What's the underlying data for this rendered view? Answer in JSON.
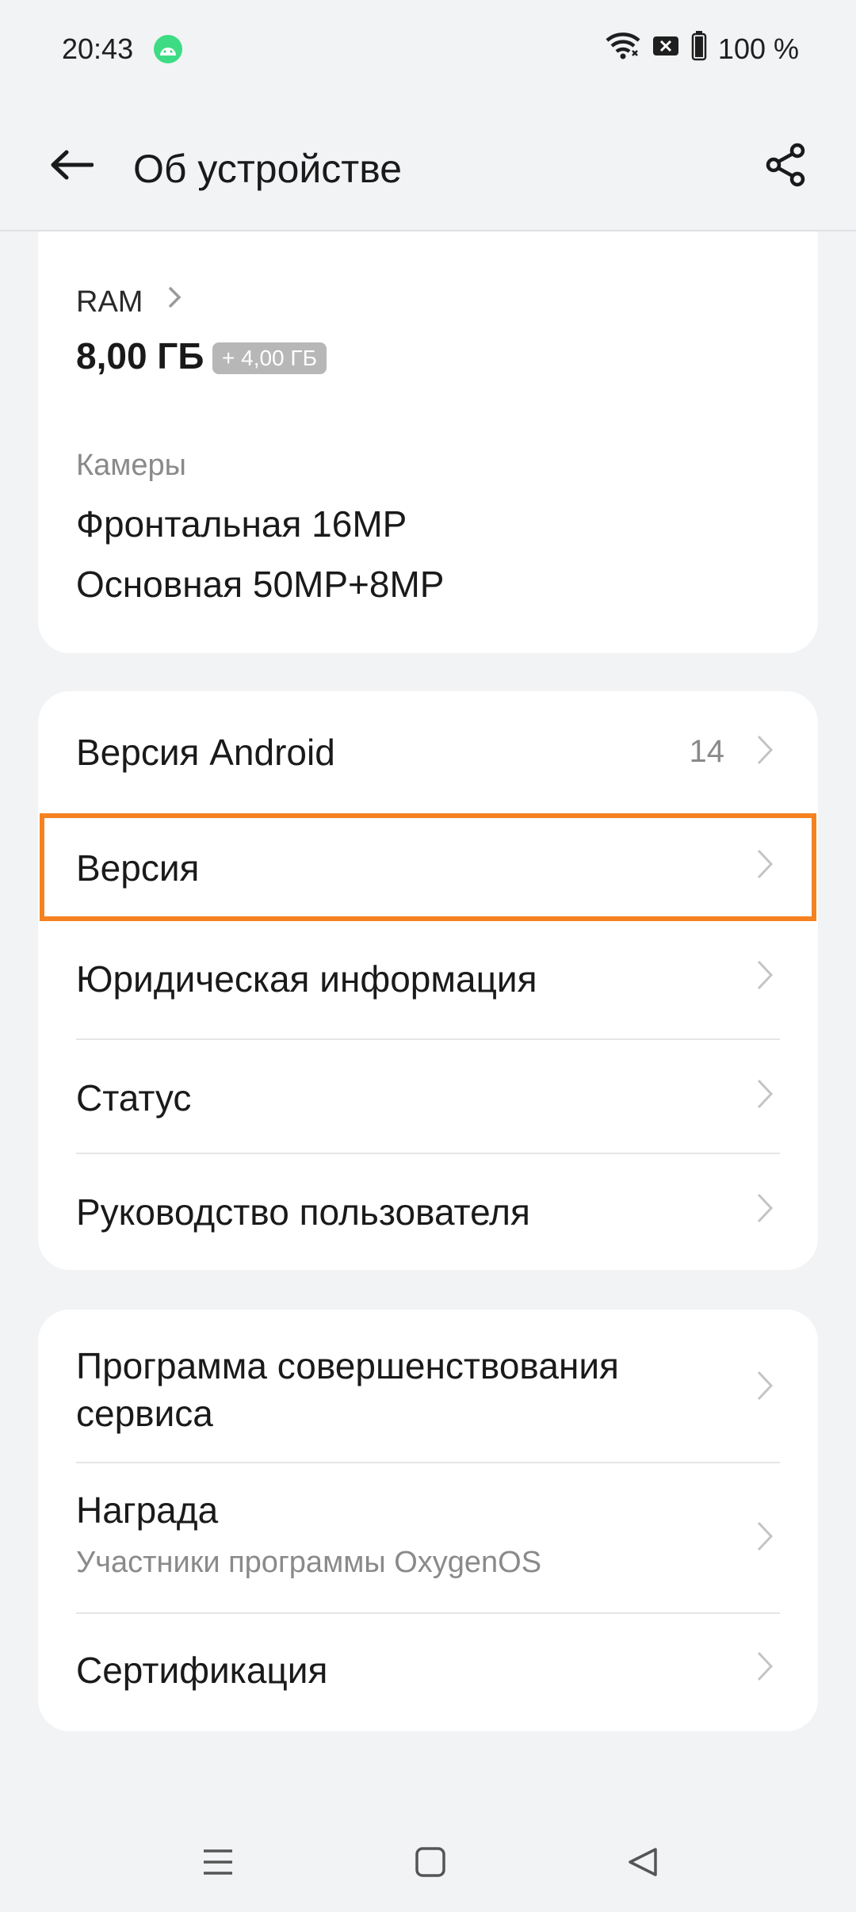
{
  "status_bar": {
    "time": "20:43",
    "battery_text": "100 %",
    "icons": [
      "android-notification-icon",
      "wifi-icon",
      "sim-blocked-icon",
      "battery-icon"
    ]
  },
  "header": {
    "title": "Об устройстве",
    "back_icon": "back-arrow-icon",
    "share_icon": "share-icon"
  },
  "specs": {
    "ram_label": "RAM",
    "ram_value": "8,00 ГБ",
    "ram_extra": "+ 4,00 ГБ",
    "cameras_label": "Камеры",
    "camera_front": "Фронтальная 16MP",
    "camera_main": "Основная 50MP+8MP"
  },
  "software_items": [
    {
      "label": "Версия Android",
      "value": "14"
    },
    {
      "label": "Версия"
    },
    {
      "label": "Юридическая информация"
    },
    {
      "label": "Статус"
    },
    {
      "label": "Руководство пользователя"
    }
  ],
  "program_items": [
    {
      "label_line1": "Программа совершенствования",
      "label_line2": "сервиса"
    },
    {
      "label": "Награда",
      "sub": "Участники программы OxygenOS"
    },
    {
      "label": "Сертификация"
    }
  ],
  "highlight_color": "#f58220",
  "nav": [
    "menu-icon",
    "home-icon",
    "back-icon"
  ]
}
